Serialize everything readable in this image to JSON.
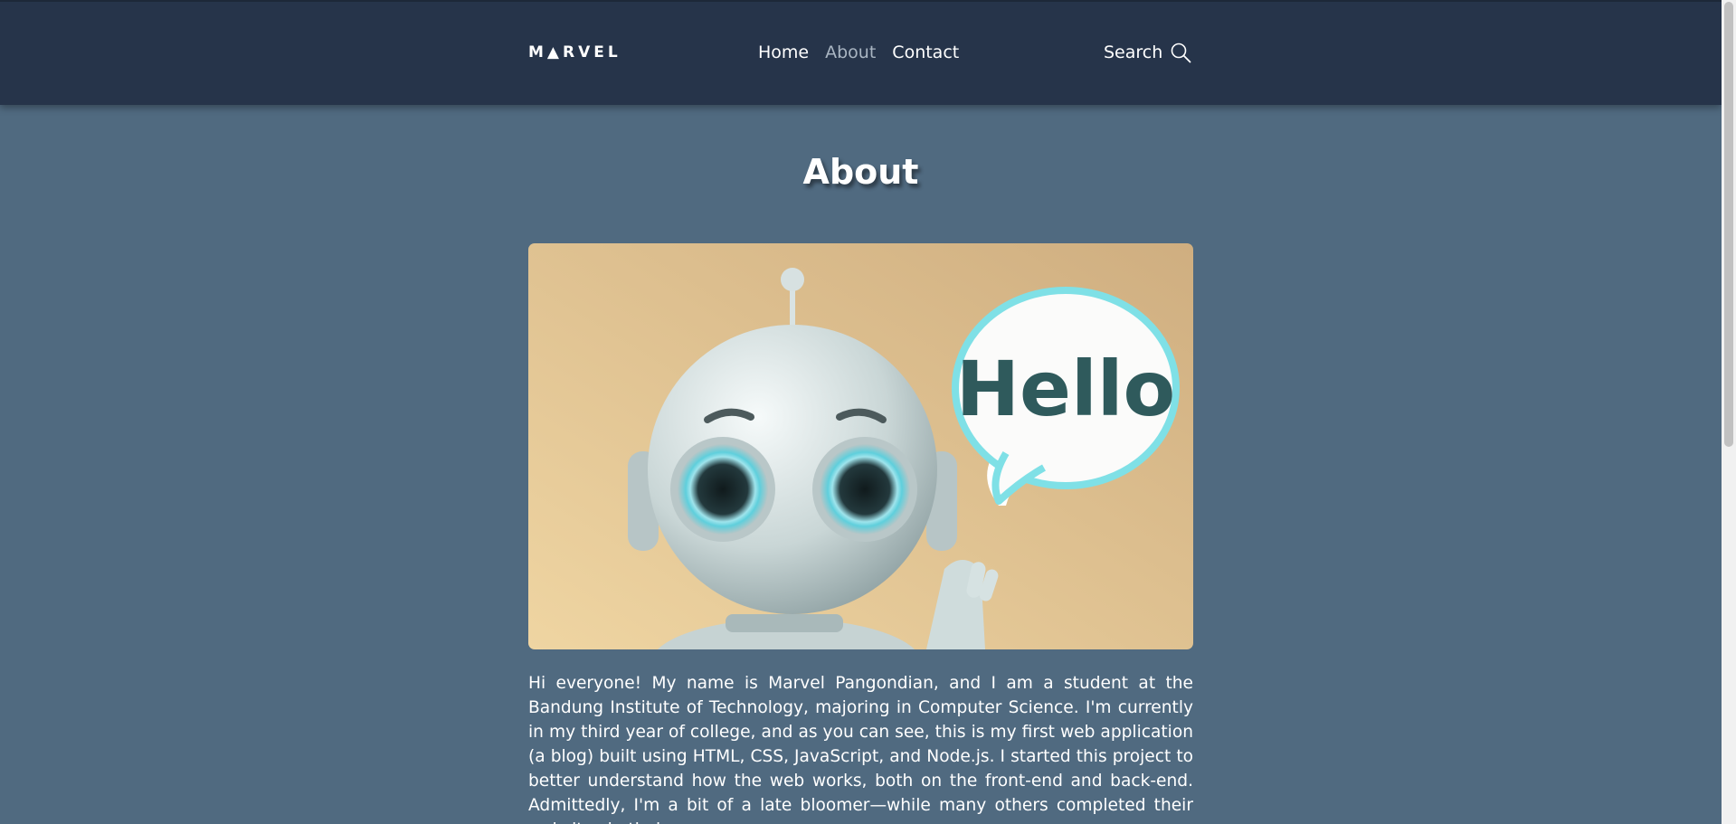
{
  "header": {
    "logo": "M▲RVEL",
    "nav": [
      {
        "label": "Home",
        "active": false
      },
      {
        "label": "About",
        "active": true
      },
      {
        "label": "Contact",
        "active": false
      }
    ],
    "search_label": "Search",
    "search_icon": "search-icon"
  },
  "main": {
    "title": "About",
    "hero_bubble_text": "Hello",
    "paragraph": "Hi everyone! My name is Marvel Pangondian, and I am a student at the Bandung Institute of Technology, majoring in Computer Science. I'm currently in my third year of college, and as you can see, this is my first web application (a blog) built using HTML, CSS, JavaScript, and Node.js. I started this project to better understand how the web works, both on the front-end and back-end. Admittedly, I'm a bit of a late bloomer—while many others completed their websites in their"
  },
  "colors": {
    "header_bg": "#26344a",
    "page_bg": "#506a80",
    "nav_active": "#a9b5c2",
    "bubble_outline": "#7fe0e6",
    "hello_text": "#2f5a5c"
  }
}
